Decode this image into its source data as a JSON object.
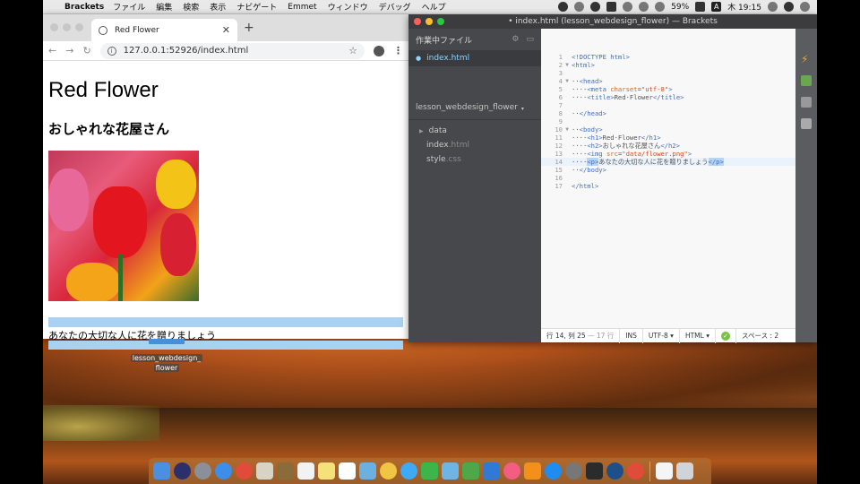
{
  "menubar": {
    "app": "Brackets",
    "items": [
      "ファイル",
      "編集",
      "検索",
      "表示",
      "ナビゲート",
      "Emmet",
      "ウィンドウ",
      "デバッグ",
      "ヘルプ"
    ],
    "battery": "59%",
    "input_source": "A",
    "clock": "木 19:15"
  },
  "chrome": {
    "tab_title": "Red Flower",
    "url": "127.0.0.1:52926/index.html"
  },
  "webpage": {
    "h1": "Red Flower",
    "h2": "おしゃれな花屋さん",
    "paragraph": "あなたの大切な人に花を贈りましょう"
  },
  "desktop": {
    "folder_label_line1": "lesson_webdesign_",
    "folder_label_line2": "flower"
  },
  "brackets": {
    "title": "• index.html (lesson_webdesign_flower) — Brackets",
    "working_files_header": "作業中ファイル",
    "working_file": "index.html",
    "project_name": "lesson_webdesign_flower",
    "tree": [
      {
        "name": "data",
        "ext": "",
        "type": "folder"
      },
      {
        "name": "index",
        "ext": ".html",
        "type": "file"
      },
      {
        "name": "style",
        "ext": ".css",
        "type": "file"
      }
    ],
    "status": {
      "position": "行 14, 列 25",
      "lines": "— 17 行",
      "mode": "INS",
      "encoding": "UTF-8 ▾",
      "language": "HTML ▾",
      "indent": "スペース : 2"
    }
  },
  "colors": {
    "selection": "#b7d5f2",
    "tag": "#446fbd",
    "attr": "#c16e2e",
    "string": "#d94d1e"
  }
}
